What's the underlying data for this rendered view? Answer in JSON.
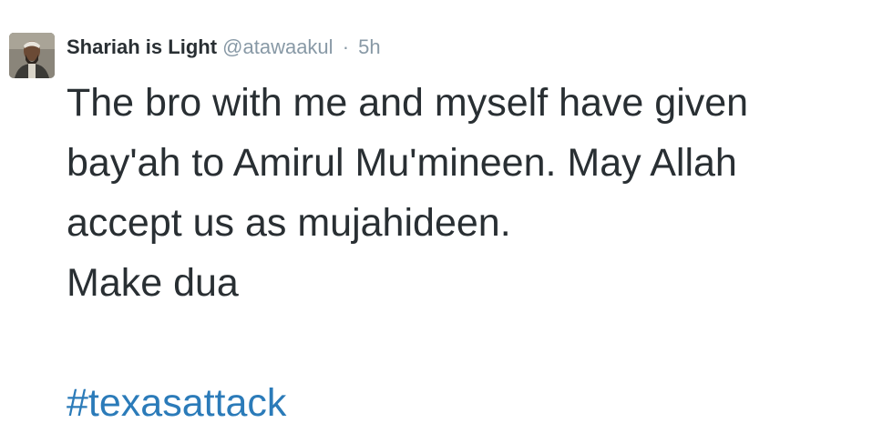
{
  "tweet": {
    "author": {
      "name": "Shariah is Light",
      "handle": "@atawaakul",
      "separator": "·",
      "timestamp": "5h"
    },
    "lines": [
      "The bro with me and myself have given",
      "bay'ah to Amirul Mu'mineen. May Allah",
      "accept us as mujahideen.",
      "Make dua"
    ],
    "hashtag": "#texasattack"
  },
  "colors": {
    "text": "#292f33",
    "muted": "#8899a6",
    "link": "#2b7bb9"
  },
  "icons": {
    "avatar": "user-avatar-photo"
  }
}
